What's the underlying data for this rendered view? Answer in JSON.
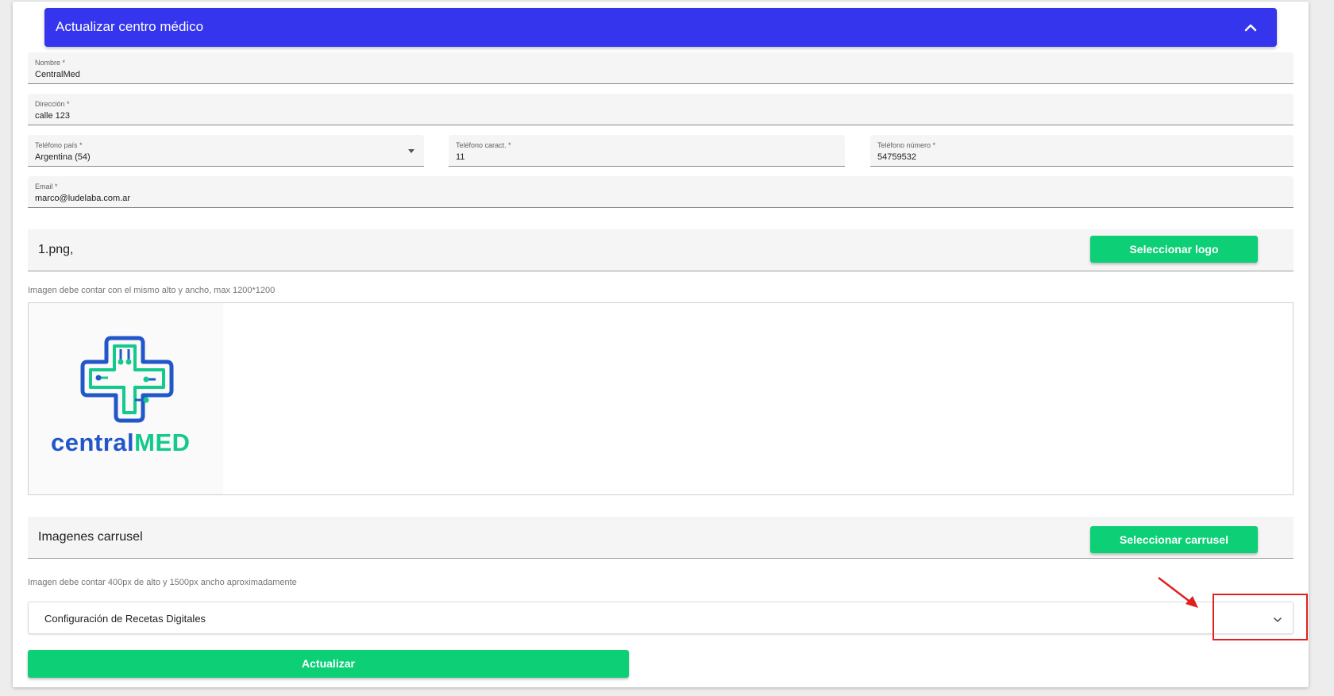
{
  "header": {
    "title": "Actualizar centro médico"
  },
  "fields": {
    "nombre": {
      "label": "Nombre *",
      "value": "CentralMed"
    },
    "direccion": {
      "label": "Dirección *",
      "value": "calle 123"
    },
    "telefono_pais": {
      "label": "Teléfono país *",
      "value": "Argentina (54)"
    },
    "telefono_caract": {
      "label": "Teléfono caract. *",
      "value": "11"
    },
    "telefono_numero": {
      "label": "Teléfono número *",
      "value": "54759532"
    },
    "email": {
      "label": "Email *",
      "value": "marco@ludelaba.com.ar"
    }
  },
  "logo_upload": {
    "filename": "1.png,",
    "button_label": "Seleccionar logo",
    "hint": "Imagen debe contar con el mismo alto y ancho, max 1200*1200",
    "preview_logo": {
      "part1": "central",
      "part2": "MED"
    }
  },
  "carousel_upload": {
    "title": "Imagenes carrusel",
    "button_label": "Seleccionar carrusel",
    "hint": "Imagen debe contar 400px de alto y 1500px ancho aproximadamente"
  },
  "recetas": {
    "title": "Configuración de Recetas Digitales"
  },
  "submit": {
    "label": "Actualizar"
  },
  "colors": {
    "header": "#3535ee",
    "accent_green": "#0ccf76",
    "annotation_red": "#e02020",
    "logo_blue": "#2357c9",
    "logo_green": "#13c98b"
  },
  "icons": {
    "header_toggle": "chevron-up-icon",
    "accordion_toggle": "chevron-down-icon",
    "select_caret": "caret-down-icon"
  }
}
